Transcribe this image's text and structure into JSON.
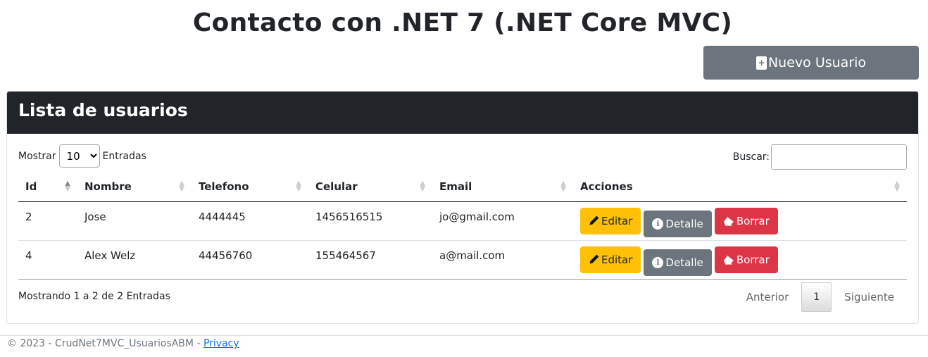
{
  "page": {
    "title": "Contacto con .NET 7 (.NET Core MVC)"
  },
  "new_user_button": {
    "label": "Nuevo Usuario"
  },
  "card": {
    "title": "Lista de usuarios"
  },
  "length_control": {
    "prefix": "Mostrar",
    "value": "10",
    "suffix": "Entradas"
  },
  "search": {
    "label": "Buscar:",
    "value": ""
  },
  "table": {
    "headers": [
      "Id",
      "Nombre",
      "Telefono",
      "Celular",
      "Email",
      "Acciones"
    ],
    "rows": [
      {
        "id": "2",
        "nombre": "Jose",
        "telefono": "4444445",
        "celular": "1456516515",
        "email": "jo@gmail.com"
      },
      {
        "id": "4",
        "nombre": "Alex Welz",
        "telefono": "44456760",
        "celular": "155464567",
        "email": "a@mail.com"
      }
    ],
    "actions": {
      "edit": "Editar",
      "detail": "Detalle",
      "delete": "Borrar"
    }
  },
  "info": {
    "text": "Mostrando 1 a 2 de 2 Entradas"
  },
  "pagination": {
    "previous": "Anterior",
    "current": "1",
    "next": "Siguiente"
  },
  "footer": {
    "text": "© 2023 - CrudNet7MVC_UsuariosABM - ",
    "link": "Privacy"
  },
  "colors": {
    "header_bg": "#212529",
    "edit": "#ffc107",
    "detail": "#6c757d",
    "delete": "#dc3545",
    "link": "#0d6efd"
  },
  "icons": {
    "new_user": "plus-square-icon",
    "edit": "pencil-icon",
    "detail": "info-circle-icon",
    "delete": "eraser-icon"
  }
}
